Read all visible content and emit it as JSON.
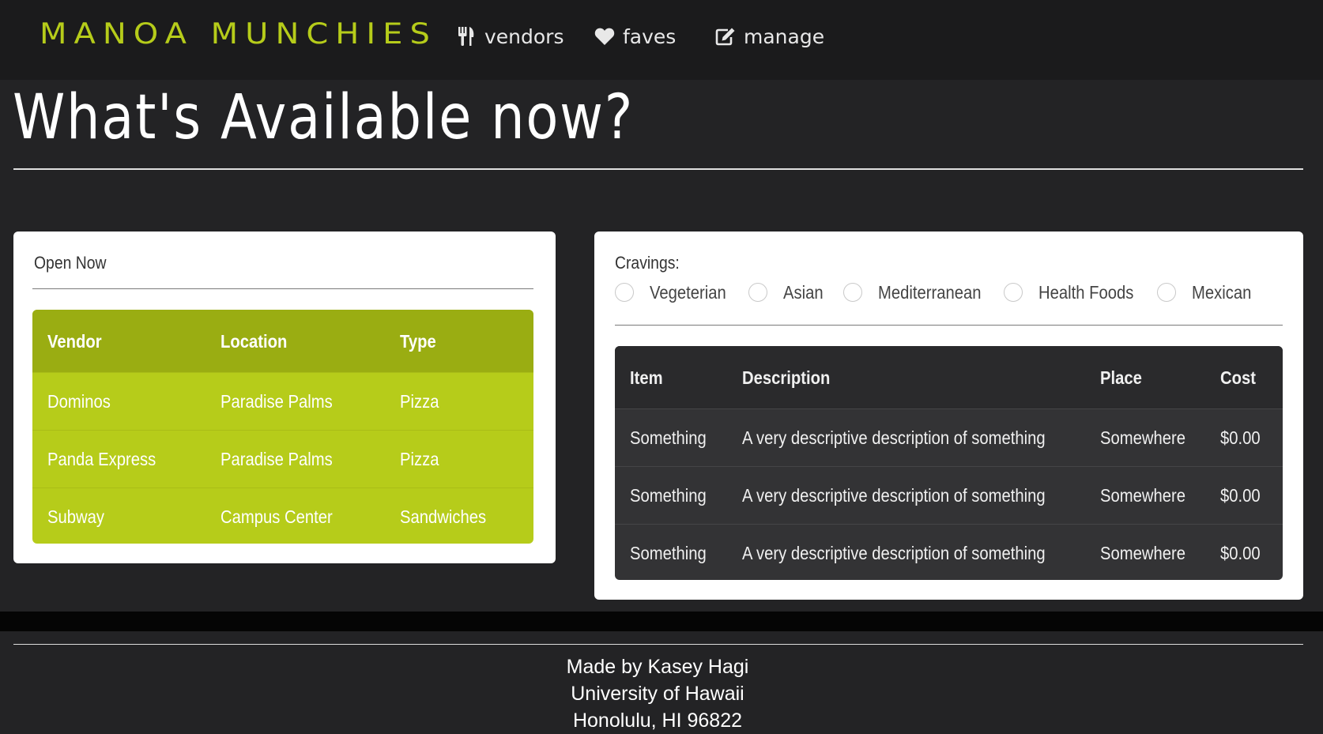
{
  "nav": {
    "brand": "MANOA MUNCHIES",
    "items": [
      {
        "label": "vendors",
        "icon": "utensils-icon"
      },
      {
        "label": "faves",
        "icon": "heart-icon"
      },
      {
        "label": "manage",
        "icon": "edit-icon"
      }
    ]
  },
  "page": {
    "title": "What's Available now?"
  },
  "open_now": {
    "heading": "Open Now",
    "columns": [
      "Vendor",
      "Location",
      "Type"
    ],
    "rows": [
      [
        "Dominos",
        "Paradise Palms",
        "Pizza"
      ],
      [
        "Panda Express",
        "Paradise Palms",
        "Pizza"
      ],
      [
        "Subway",
        "Campus Center",
        "Sandwiches"
      ]
    ]
  },
  "cravings": {
    "heading": "Cravings:",
    "options": [
      "Vegeterian",
      "Asian",
      "Mediterranean",
      "Health Foods",
      "Mexican"
    ],
    "columns": [
      "Item",
      "Description",
      "Place",
      "Cost"
    ],
    "rows": [
      [
        "Something",
        "A very descriptive description of something",
        "Somewhere",
        "$0.00"
      ],
      [
        "Something",
        "A very descriptive description of something",
        "Somewhere",
        "$0.00"
      ],
      [
        "Something",
        "A very descriptive description of something",
        "Somewhere",
        "$0.00"
      ]
    ]
  },
  "footer": {
    "lines": [
      "Made by Kasey Hagi",
      "University of Hawaii",
      "Honolulu, HI 96822"
    ]
  },
  "colors": {
    "accent": "#b6cc1a",
    "accent_dark": "#9aad12",
    "background": "#232325",
    "navbar": "#1b1b1c"
  }
}
